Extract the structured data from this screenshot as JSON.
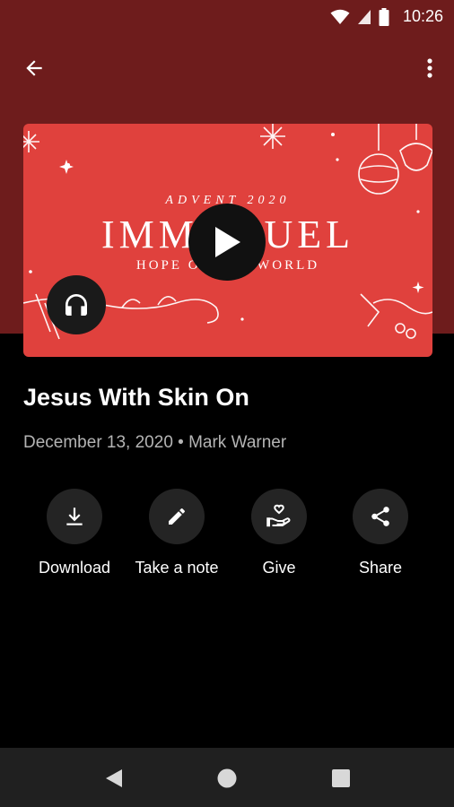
{
  "status_bar": {
    "time": "10:26"
  },
  "app_bar": {
    "back_icon": "arrow-back-icon",
    "more_icon": "more-vertical-icon"
  },
  "artwork": {
    "subtitle": "ADVENT 2020",
    "title": "IMMANUEL",
    "tagline": "HOPE OF THE WORLD",
    "background_color": "#e0413d"
  },
  "sermon": {
    "title": "Jesus With Skin On",
    "meta": "December 13, 2020 • Mark Warner"
  },
  "actions": [
    {
      "label": "Download",
      "icon": "download-icon"
    },
    {
      "label": "Take a note",
      "icon": "pencil-icon"
    },
    {
      "label": "Give",
      "icon": "give-hand-heart-icon"
    },
    {
      "label": "Share",
      "icon": "share-icon"
    }
  ],
  "colors": {
    "header": "#6e1c1c",
    "accent": "#e0413d",
    "background": "#000000",
    "nav_bar": "#202020"
  }
}
